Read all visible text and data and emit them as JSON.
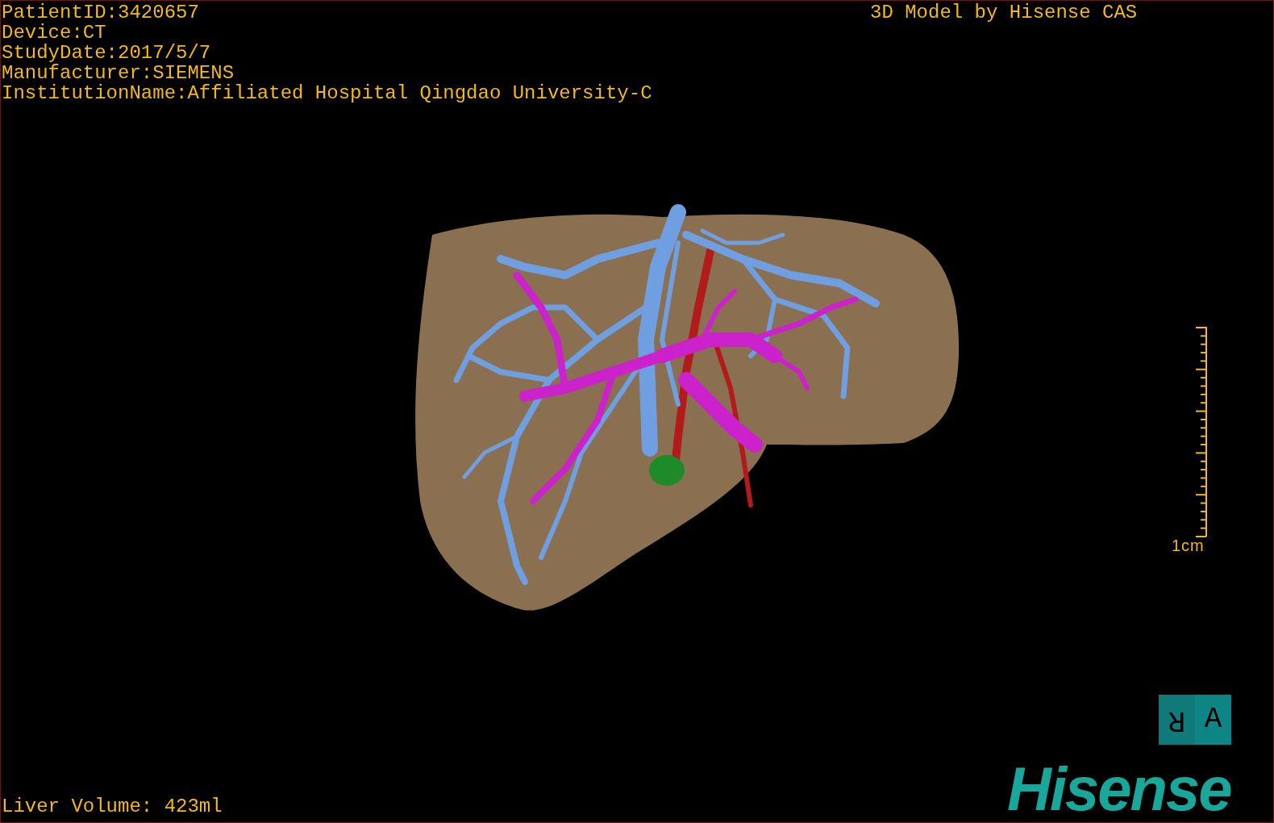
{
  "patient_info": [
    "PatientID:3420657",
    "Device:CT",
    "StudyDate:2017/5/7",
    "Manufacturer:SIEMENS",
    "InstitutionName:Affiliated Hospital Qingdao University-C"
  ],
  "header_right": "3D Model by Hisense CAS",
  "scale_bar": {
    "label": "1cm"
  },
  "orientation_cube": {
    "left_face": "R",
    "right_face": "A"
  },
  "logo": "Hisense",
  "liver_volume": "Liver Volume: 423ml"
}
